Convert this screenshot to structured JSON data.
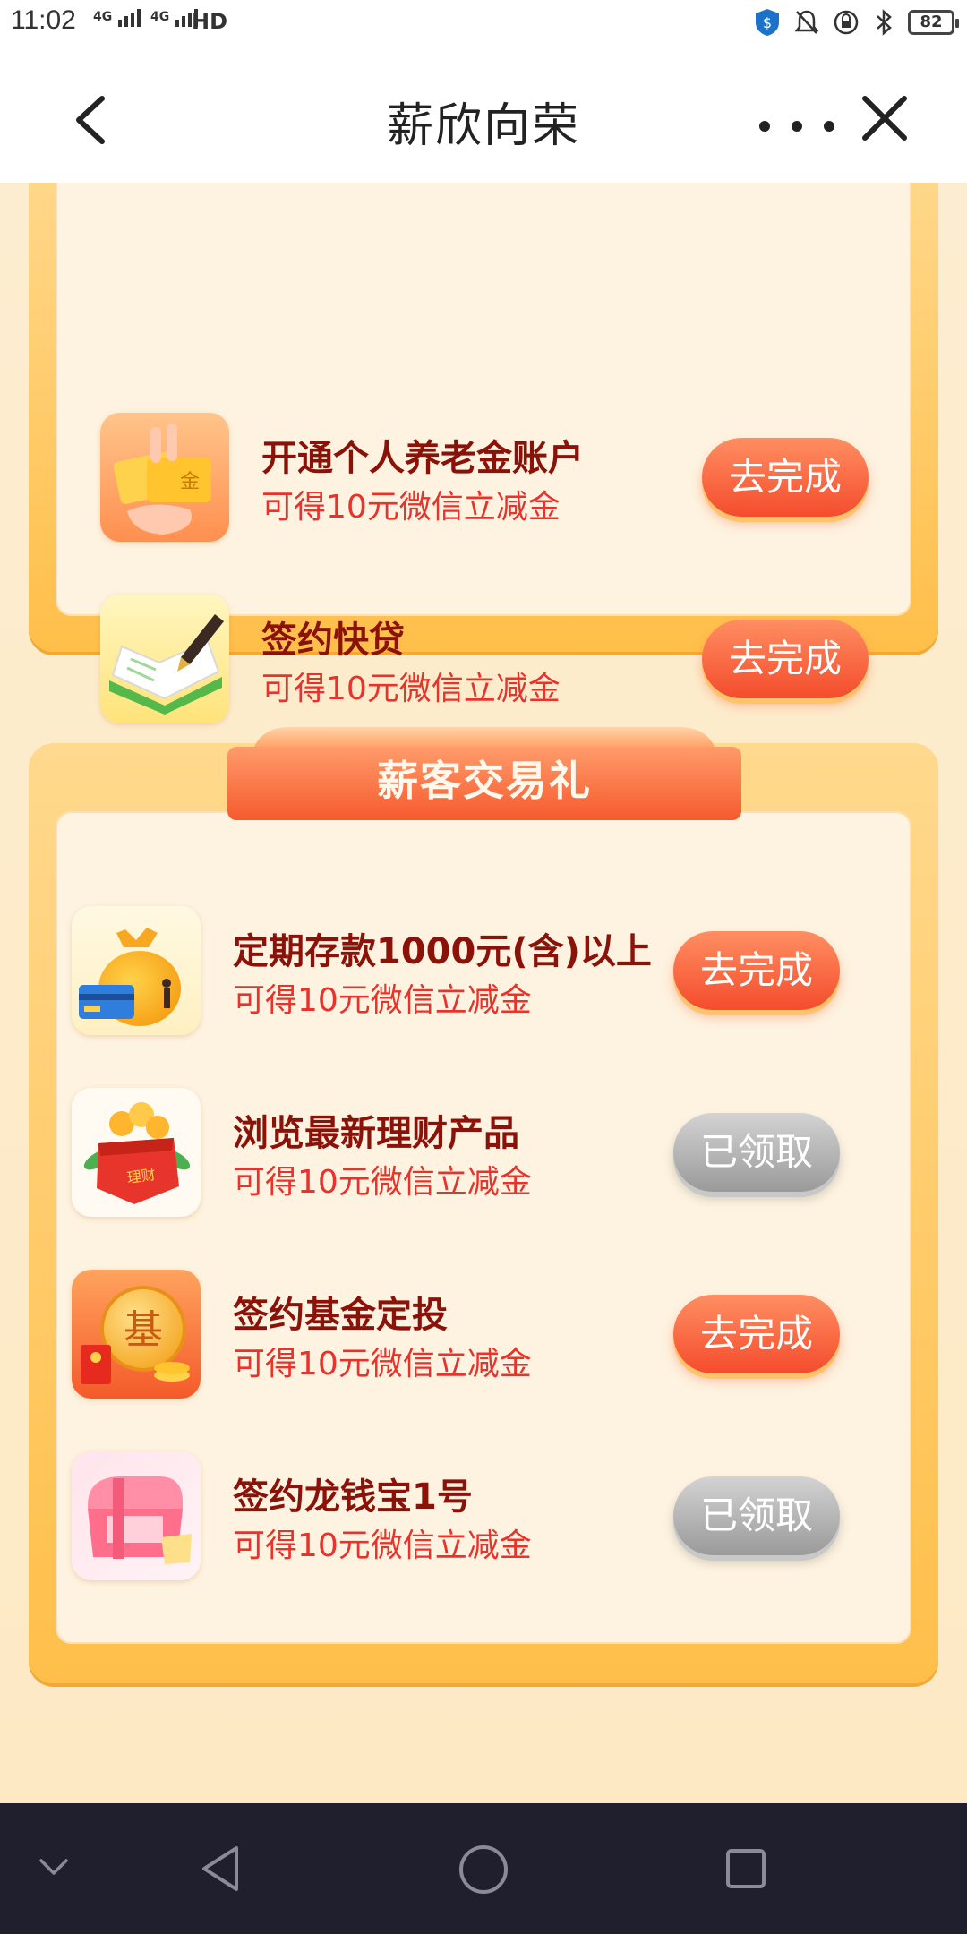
{
  "status_bar": {
    "time": "11:02",
    "signal_1": "4G",
    "signal_2": "4G",
    "hd_label": "HD",
    "battery": "82"
  },
  "header": {
    "title": "薪欣向荣"
  },
  "section_top": {
    "tasks": [
      {
        "title": "开通个人养老金账户",
        "subtitle": "可得10元微信立减金",
        "button": "去完成",
        "icon": "gold-card-hand-icon"
      },
      {
        "title": "签约快贷",
        "subtitle": "可得10元微信立减金",
        "button": "去完成",
        "icon": "pen-book-icon"
      }
    ]
  },
  "section_trade": {
    "title": "薪客交易礼",
    "tasks": [
      {
        "title": "定期存款1000元(含)以上",
        "subtitle": "可得10元微信立减金",
        "button": "去完成",
        "icon": "money-bag-icon"
      },
      {
        "title": "浏览最新理财产品",
        "subtitle": "可得10元微信立减金",
        "button": "已领取",
        "icon": "wealth-gift-box-icon"
      },
      {
        "title": "签约基金定投",
        "subtitle": "可得10元微信立减金",
        "button": "去完成",
        "icon": "fund-coin-icon"
      },
      {
        "title": "签约龙钱宝1号",
        "subtitle": "可得10元微信立减金",
        "button": "已领取",
        "icon": "treasure-chest-icon"
      }
    ],
    "ribbon_badge": "理财",
    "coin_char": "基",
    "card_char": "金"
  },
  "colors": {
    "accent": "#f44c2c",
    "title_red": "#8a1209",
    "subtitle_red": "#e8332c",
    "card_border": "#ffbf4a",
    "navbar": "#1f1f2e"
  }
}
